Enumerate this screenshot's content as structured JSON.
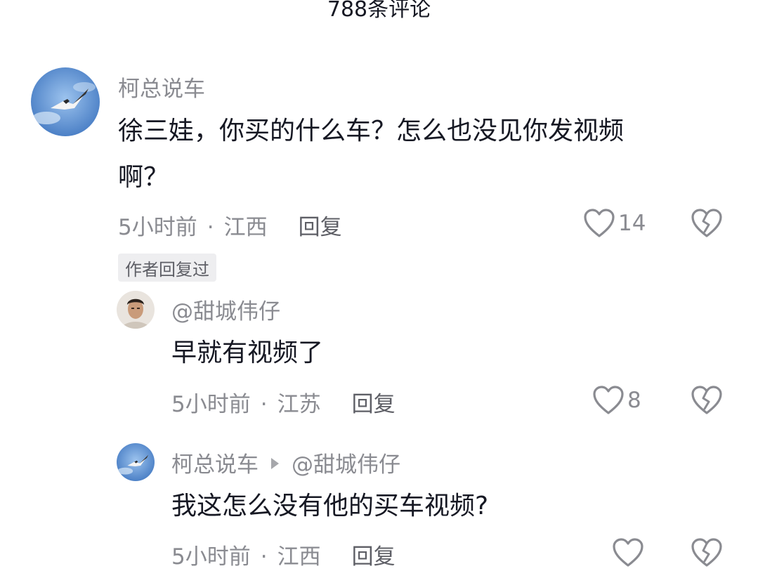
{
  "header": {
    "comment_count_title": "788条评论"
  },
  "comments": [
    {
      "username": "柯总说车",
      "text_line1": "徐三娃，你买的什么车？怎么也没见你发视频",
      "text_line2": "啊？",
      "time": "5小时前",
      "separator": "·",
      "location": "江西",
      "reply_label": "回复",
      "likes": "14",
      "author_badge": "作者回复过",
      "avatar_icon": "seagull-avatar-icon"
    }
  ],
  "replies": [
    {
      "username": "@甜城伟仔",
      "text": "早就有视频了",
      "time": "5小时前",
      "separator": "·",
      "location": "江苏",
      "reply_label": "回复",
      "likes": "8",
      "avatar_icon": "man-avatar-icon"
    },
    {
      "username": "柯总说车",
      "reply_to": "@甜城伟仔",
      "text": "我这怎么没有他的买车视频?",
      "time": "5小时前",
      "separator": "·",
      "location": "江西",
      "reply_label": "回复",
      "likes": "",
      "avatar_icon": "seagull-avatar-icon"
    }
  ],
  "icons": {
    "like": "heart-outline-icon",
    "dislike": "broken-heart-icon"
  },
  "colors": {
    "text_primary": "#161823",
    "text_secondary": "#8a8b91",
    "sky_blue": "#5a8fd0"
  }
}
